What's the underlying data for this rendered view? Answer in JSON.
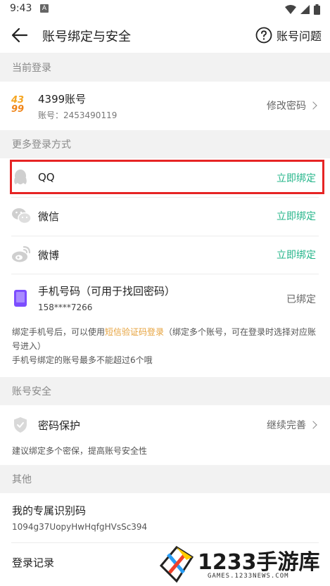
{
  "status_bar": {
    "time": "9:43",
    "notif_letter": "A"
  },
  "header": {
    "title": "账号绑定与安全",
    "help_label": "账号问题"
  },
  "sections": {
    "current_login": "当前登录",
    "more_login": "更多登录方式",
    "account_security": "账号安全",
    "other": "其他"
  },
  "current_account": {
    "logo_top": "43",
    "logo_bottom": "99",
    "title": "4399账号",
    "account_line": "账号：2453490119",
    "action": "修改密码"
  },
  "bindings": [
    {
      "name": "QQ",
      "action": "立即绑定"
    },
    {
      "name": "微信",
      "action": "立即绑定"
    },
    {
      "name": "微博",
      "action": "立即绑定"
    }
  ],
  "phone": {
    "title": "手机号码（可用于找回密码）",
    "number": "158****7266",
    "status": "已绑定"
  },
  "phone_note": {
    "part1": "绑定手机号后，可以使用",
    "link": "短信验证码登录",
    "part2": "（绑定多个账号，可在登录时选择对应账号进入）",
    "line2": "手机号绑定的账号最多不能超过6个哦"
  },
  "security": {
    "title": "密码保护",
    "action": "继续完善",
    "note": "建议绑定多个密保，提高账号安全性"
  },
  "other": {
    "id_title": "我的专属识别码",
    "id_value": "1094g37UopyHwHqfgHVsSc394",
    "login_record": "登录记录"
  },
  "watermark": {
    "brand": "1233手游库",
    "url": "GAMES.1233NEWS.COM"
  },
  "colors": {
    "accent_green": "#24b58a",
    "highlight_red": "#e62424",
    "link_orange": "#e6a23c"
  }
}
